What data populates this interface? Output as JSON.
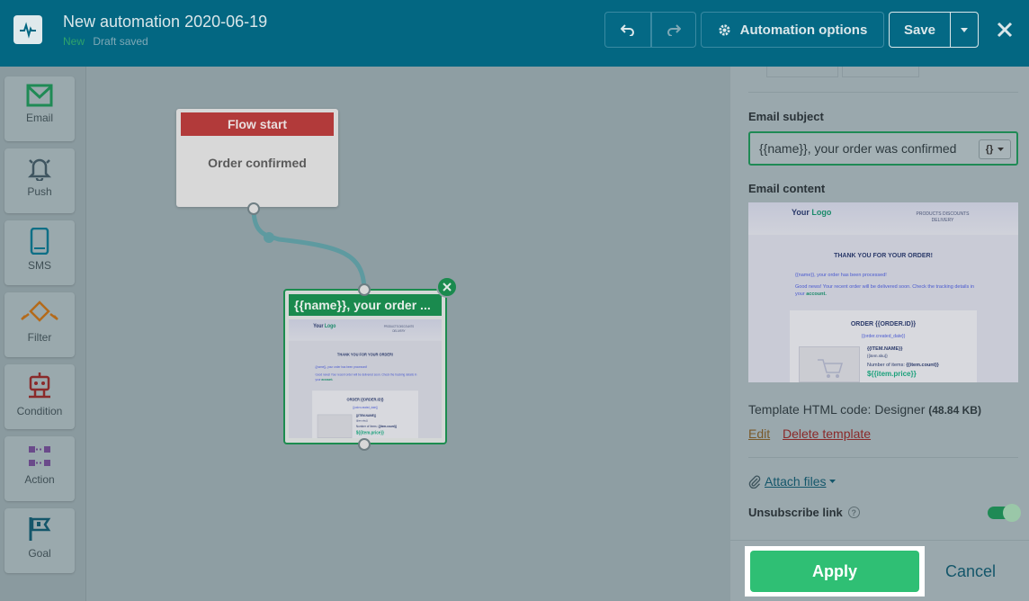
{
  "header": {
    "title": "New automation 2020-06-19",
    "status_new": "New",
    "status_draft": "Draft saved",
    "automation_options_label": "Automation options",
    "save_label": "Save",
    "icons": [
      "pulse-icon",
      "undo-icon",
      "redo-icon",
      "gear-icon",
      "chevron-down-icon",
      "close-icon"
    ]
  },
  "toolbar": {
    "items": [
      {
        "label": "Email",
        "icon": "envelope-icon",
        "color": "#1f8a55"
      },
      {
        "label": "Push",
        "icon": "bell-icon",
        "color": "#3f5560"
      },
      {
        "label": "SMS",
        "icon": "phone-icon",
        "color": "#0e6f86"
      },
      {
        "label": "Filter",
        "icon": "filter-icon",
        "color": "#b46a1a"
      },
      {
        "label": "Condition",
        "icon": "condition-icon",
        "color": "#8a2a2a"
      },
      {
        "label": "Action",
        "icon": "action-icon",
        "color": "#6a4a8a"
      },
      {
        "label": "Goal",
        "icon": "flag-icon",
        "color": "#14566a"
      }
    ]
  },
  "canvas": {
    "flow_start": {
      "header": "Flow start",
      "body": "Order confirmed"
    },
    "email_node": {
      "header": "{{name}}, your order ..."
    }
  },
  "panel": {
    "email_subject_label": "Email subject",
    "email_subject_value": "{{name}}, your order was confirmed",
    "var_button_label": "{}",
    "email_content_label": "Email content",
    "template_prefix": "Template HTML code:",
    "template_type": "Designer",
    "template_size": "(48.84 KB)",
    "edit_label": "Edit",
    "delete_label": "Delete template",
    "attach_label": "Attach files",
    "unsubscribe_label": "Unsubscribe link",
    "help_glyph": "?",
    "unsubscribe_enabled": true,
    "apply_label": "Apply",
    "cancel_label": "Cancel"
  },
  "template_preview": {
    "logo_your": "Your",
    "logo_logo": "Logo",
    "nav": "PRODUCTS  DISCOUNTS DELIVERY",
    "thanks": "THANK YOU FOR YOUR ORDER!",
    "p1": "{{name}}, your order has been processed!",
    "p2_a": "Good news! Your recent order will be delivered soon. Check the tracking details in your",
    "p2_link": "account.",
    "order": "ORDER {{ORDER.ID}}",
    "order_date": "{{order.created_date}}",
    "item_name": "{{ITEM.NAME}}",
    "item_var": "{{item.sku}}",
    "item_count_prefix": "Number of items:",
    "item_count": "{{item.count}}",
    "item_price": "${{item.price}}"
  }
}
